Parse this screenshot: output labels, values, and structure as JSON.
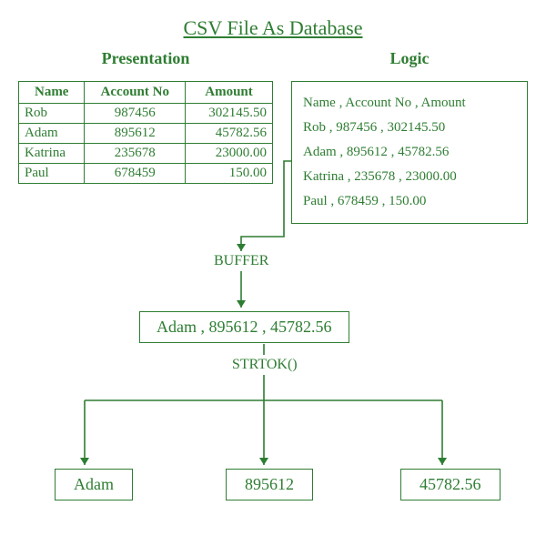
{
  "colors": {
    "accent": "#2e7d32"
  },
  "title": "CSV File As Database",
  "presentation": {
    "heading": "Presentation",
    "headers": {
      "name": "Name",
      "account": "Account No",
      "amount": "Amount"
    },
    "rows": [
      {
        "name": "Rob",
        "account": "987456",
        "amount": "302145.50"
      },
      {
        "name": "Adam",
        "account": "895612",
        "amount": "45782.56"
      },
      {
        "name": "Katrina",
        "account": "235678",
        "amount": "23000.00"
      },
      {
        "name": "Paul",
        "account": "678459",
        "amount": "150.00"
      }
    ]
  },
  "logic": {
    "heading": "Logic",
    "lines": [
      "Name , Account No , Amount",
      "Rob , 987456 , 302145.50",
      "Adam , 895612 , 45782.56",
      "Katrina , 235678 , 23000.00",
      "Paul , 678459 , 150.00"
    ]
  },
  "buffer": {
    "label": "BUFFER",
    "value": "Adam , 895612 , 45782.56"
  },
  "strtok": {
    "label": "STRTOK()",
    "tokens": [
      "Adam",
      "895612",
      "45782.56"
    ]
  }
}
